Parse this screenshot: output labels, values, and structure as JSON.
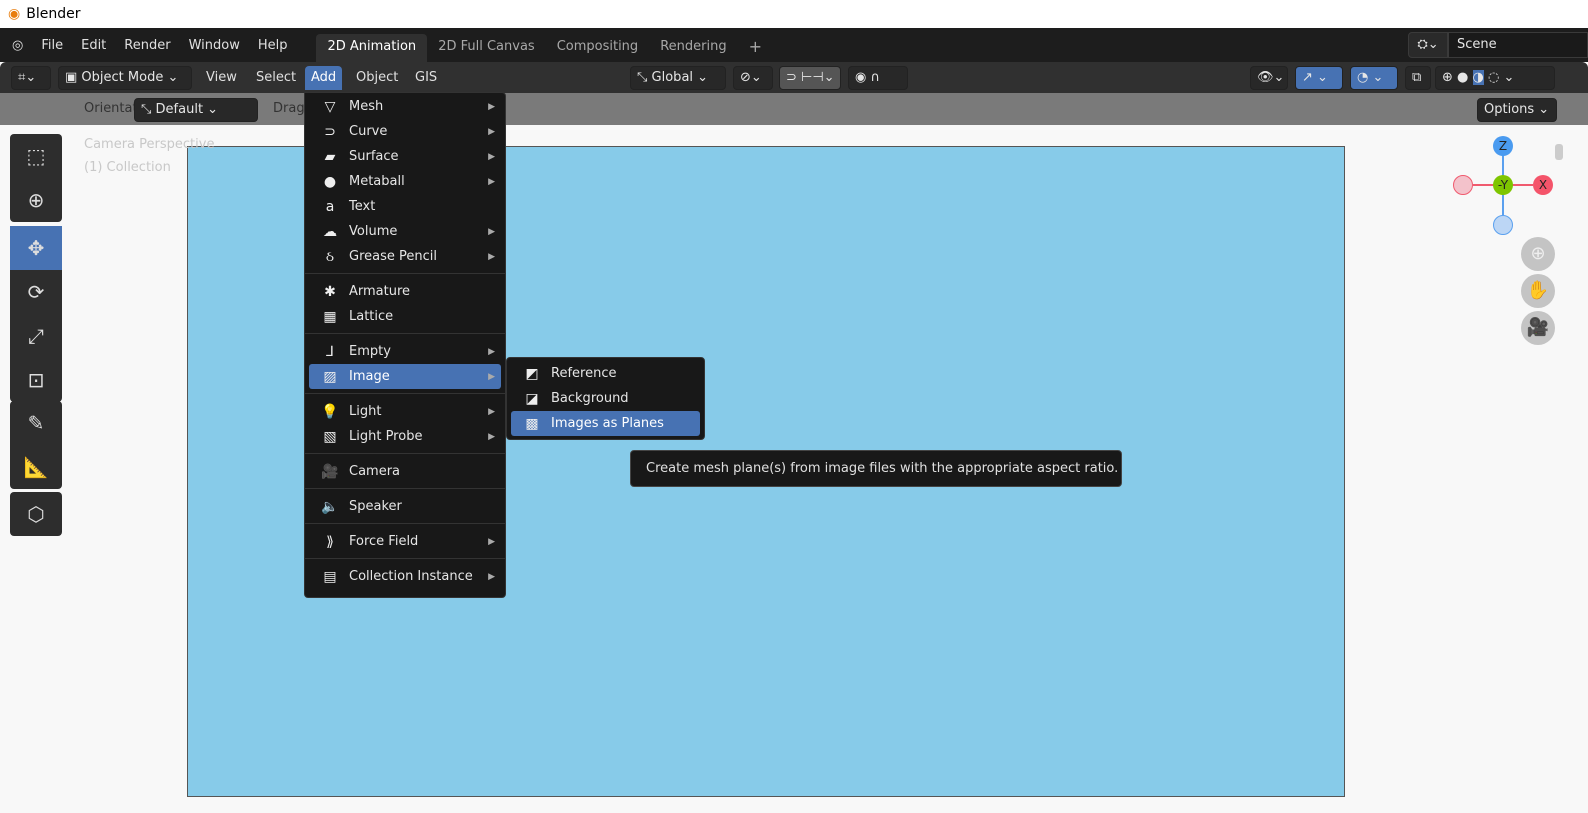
{
  "window": {
    "title": "Blender"
  },
  "topbar": {
    "menus": [
      "File",
      "Edit",
      "Render",
      "Window",
      "Help"
    ],
    "tabs": [
      "2D Animation",
      "2D Full Canvas",
      "Compositing",
      "Rendering"
    ],
    "add_tab": "+",
    "scene": "Scene"
  },
  "header": {
    "mode": "Object Mode",
    "menus": [
      "View",
      "Select",
      "Add",
      "Object",
      "GIS"
    ],
    "transform_orientation": "Global"
  },
  "toolsettings": {
    "orientation_label": "Orientation:",
    "orientation_value": "Default",
    "drag_label": "Drag",
    "options": "Options"
  },
  "viewport": {
    "camera_label": "Camera Perspective",
    "collection_label": "(1) Collection",
    "gizmo": {
      "z": "Z",
      "y": "-Y",
      "x": "X"
    },
    "colors": {
      "camera_bg": "#87cbe9",
      "accent": "#4772b3"
    }
  },
  "add_menu": {
    "items": [
      {
        "label": "Mesh",
        "icon": "mesh-icon",
        "sub": true
      },
      {
        "label": "Curve",
        "icon": "curve-icon",
        "sub": true
      },
      {
        "label": "Surface",
        "icon": "surface-icon",
        "sub": true
      },
      {
        "label": "Metaball",
        "icon": "metaball-icon",
        "sub": true
      },
      {
        "label": "Text",
        "icon": "text-icon",
        "sub": false
      },
      {
        "label": "Volume",
        "icon": "volume-icon",
        "sub": true
      },
      {
        "label": "Grease Pencil",
        "icon": "grease-pencil-icon",
        "sub": true
      },
      {
        "sep": true
      },
      {
        "label": "Armature",
        "icon": "armature-icon",
        "sub": false
      },
      {
        "label": "Lattice",
        "icon": "lattice-icon",
        "sub": false
      },
      {
        "sep": true
      },
      {
        "label": "Empty",
        "icon": "empty-icon",
        "sub": true
      },
      {
        "label": "Image",
        "icon": "image-icon",
        "sub": true,
        "selected": true
      },
      {
        "sep": true
      },
      {
        "label": "Light",
        "icon": "light-icon",
        "sub": true
      },
      {
        "label": "Light Probe",
        "icon": "light-probe-icon",
        "sub": true
      },
      {
        "sep": true
      },
      {
        "label": "Camera",
        "icon": "camera-icon",
        "sub": false
      },
      {
        "sep": true
      },
      {
        "label": "Speaker",
        "icon": "speaker-icon",
        "sub": false
      },
      {
        "sep": true
      },
      {
        "label": "Force Field",
        "icon": "force-field-icon",
        "sub": true
      },
      {
        "sep": true
      },
      {
        "label": "Collection Instance",
        "icon": "collection-instance-icon",
        "sub": true
      }
    ]
  },
  "image_submenu": {
    "items": [
      {
        "label": "Reference",
        "icon": "reference-icon"
      },
      {
        "label": "Background",
        "icon": "background-icon"
      },
      {
        "label": "Images as Planes",
        "icon": "images-as-planes-icon",
        "selected": true
      }
    ]
  },
  "tooltip": {
    "text": "Create mesh plane(s) from image files with the appropriate aspect ratio."
  }
}
